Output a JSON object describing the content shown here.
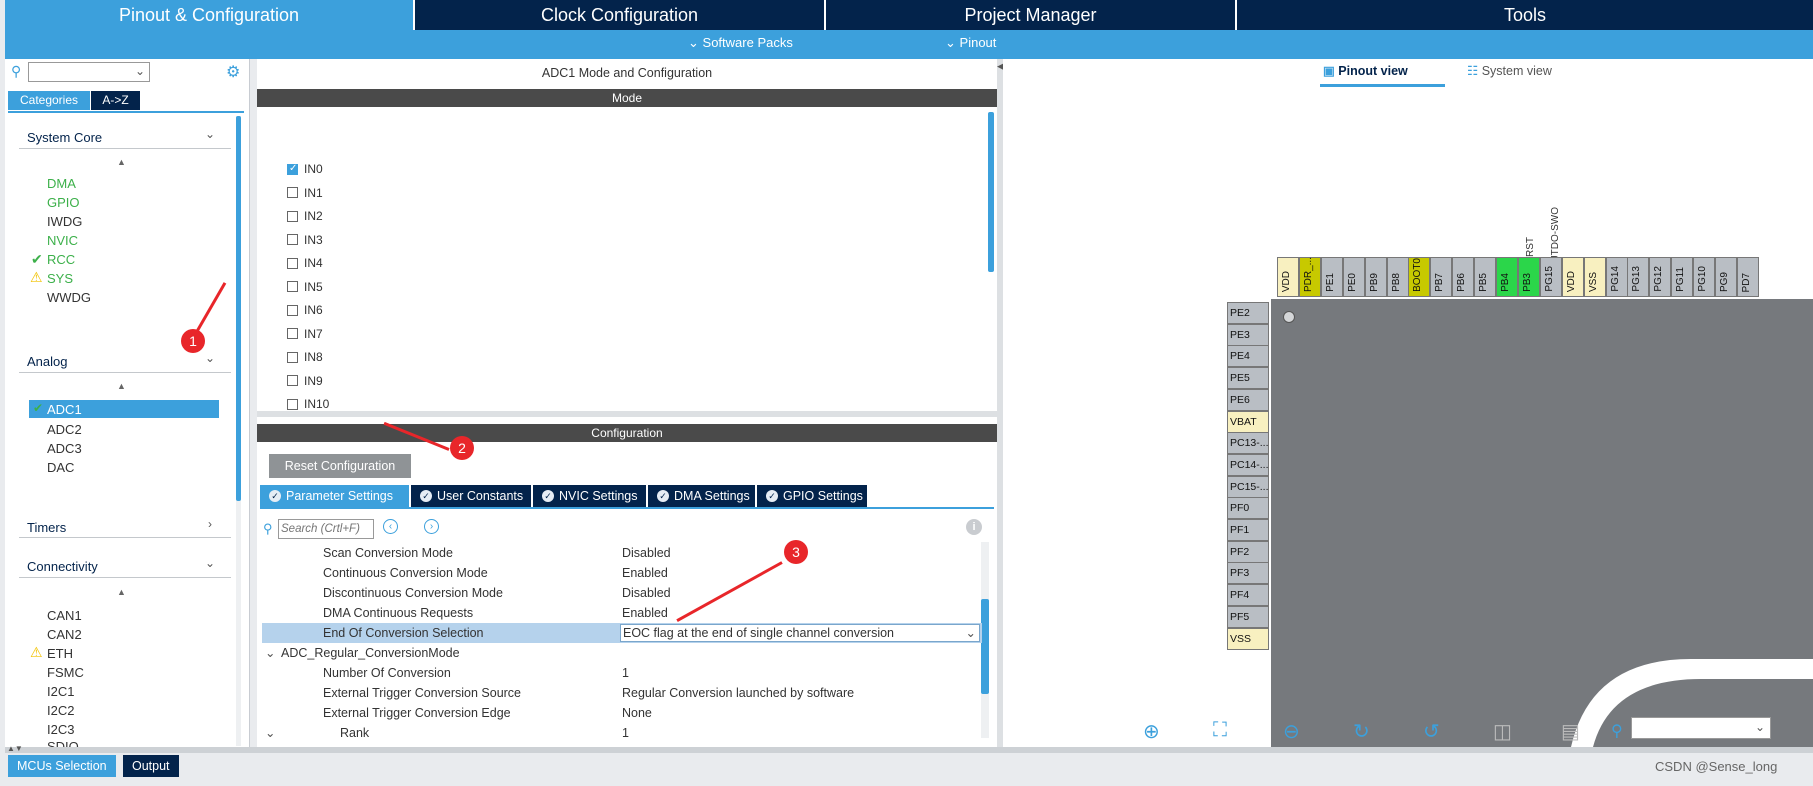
{
  "topnav": {
    "tabs": [
      {
        "label": "Pinout & Configuration"
      },
      {
        "label": "Clock Configuration"
      },
      {
        "label": "Project Manager"
      },
      {
        "label": "Tools"
      }
    ]
  },
  "subnav": {
    "software_packs": "Software Packs",
    "pinout": "Pinout"
  },
  "left": {
    "tab_categories": "Categories",
    "tab_az": "A->Z",
    "system_core": {
      "title": "System Core",
      "items": [
        {
          "label": "DMA",
          "status": "green"
        },
        {
          "label": "GPIO",
          "status": "green"
        },
        {
          "label": "IWDG",
          "status": "none"
        },
        {
          "label": "NVIC",
          "status": "green"
        },
        {
          "label": "RCC",
          "status": "check"
        },
        {
          "label": "SYS",
          "status": "warning"
        },
        {
          "label": "WWDG",
          "status": "none"
        }
      ]
    },
    "analog": {
      "title": "Analog",
      "items": [
        {
          "label": "ADC1",
          "status": "selected"
        },
        {
          "label": "ADC2",
          "status": "none"
        },
        {
          "label": "ADC3",
          "status": "none"
        },
        {
          "label": "DAC",
          "status": "none"
        }
      ]
    },
    "timers": {
      "title": "Timers"
    },
    "connectivity": {
      "title": "Connectivity",
      "items": [
        {
          "label": "CAN1",
          "status": "none"
        },
        {
          "label": "CAN2",
          "status": "none"
        },
        {
          "label": "ETH",
          "status": "warning"
        },
        {
          "label": "FSMC",
          "status": "none"
        },
        {
          "label": "I2C1",
          "status": "none"
        },
        {
          "label": "I2C2",
          "status": "none"
        },
        {
          "label": "I2C3",
          "status": "none"
        },
        {
          "label": "SDIO",
          "status": "none"
        }
      ]
    }
  },
  "center": {
    "title": "ADC1 Mode and Configuration",
    "mode_header": "Mode",
    "mode_items": [
      {
        "label": "IN0",
        "checked": true
      },
      {
        "label": "IN1",
        "checked": false
      },
      {
        "label": "IN2",
        "checked": false
      },
      {
        "label": "IN3",
        "checked": false
      },
      {
        "label": "IN4",
        "checked": false
      },
      {
        "label": "IN5",
        "checked": false
      },
      {
        "label": "IN6",
        "checked": false
      },
      {
        "label": "IN7",
        "checked": false
      },
      {
        "label": "IN8",
        "checked": false
      },
      {
        "label": "IN9",
        "checked": false
      },
      {
        "label": "IN10",
        "checked": false
      }
    ],
    "config_header": "Configuration",
    "reset_button": "Reset Configuration",
    "tabs": [
      {
        "label": "Parameter Settings"
      },
      {
        "label": "User Constants"
      },
      {
        "label": "NVIC Settings"
      },
      {
        "label": "DMA Settings"
      },
      {
        "label": "GPIO Settings"
      }
    ],
    "search_placeholder": "Search (Crtl+F)",
    "params": [
      {
        "name": "Scan Conversion Mode",
        "value": "Disabled"
      },
      {
        "name": "Continuous Conversion Mode",
        "value": "Enabled"
      },
      {
        "name": "Discontinuous Conversion Mode",
        "value": "Disabled"
      },
      {
        "name": "DMA Continuous Requests",
        "value": "Enabled"
      },
      {
        "name": "End Of Conversion Selection",
        "value": "EOC flag at the end of single channel conversion"
      },
      {
        "name": "ADC_Regular_ConversionMode",
        "value": ""
      },
      {
        "name": "Number Of Conversion",
        "value": "1"
      },
      {
        "name": "External Trigger Conversion Source",
        "value": "Regular Conversion launched by software"
      },
      {
        "name": "External Trigger Conversion Edge",
        "value": "None"
      },
      {
        "name": "Rank",
        "value": "1"
      }
    ]
  },
  "right": {
    "pinout_view": "Pinout view",
    "system_view": "System view",
    "top_labels": [
      "SYS_JTRST",
      "SYS_JTDO-SWO"
    ],
    "top_pins": [
      {
        "label": "VDD",
        "color": "#f8f0c0"
      },
      {
        "label": "PDR_...",
        "color": "#c7c900"
      },
      {
        "label": "PE1",
        "color": "#b9bec4"
      },
      {
        "label": "PE0",
        "color": "#b9bec4"
      },
      {
        "label": "PB9",
        "color": "#b9bec4"
      },
      {
        "label": "PB8",
        "color": "#b9bec4"
      },
      {
        "label": "BOOT0",
        "color": "#c7c900"
      },
      {
        "label": "PB7",
        "color": "#b9bec4"
      },
      {
        "label": "PB6",
        "color": "#b9bec4"
      },
      {
        "label": "PB5",
        "color": "#b9bec4"
      },
      {
        "label": "PB4",
        "color": "#2bd64a"
      },
      {
        "label": "PB3",
        "color": "#2bd64a"
      },
      {
        "label": "PG15",
        "color": "#b9bec4"
      },
      {
        "label": "VDD",
        "color": "#f8f0c0"
      },
      {
        "label": "VSS",
        "color": "#f8f0c0"
      },
      {
        "label": "PG14",
        "color": "#b9bec4"
      },
      {
        "label": "PG13",
        "color": "#b9bec4"
      },
      {
        "label": "PG12",
        "color": "#b9bec4"
      },
      {
        "label": "PG11",
        "color": "#b9bec4"
      },
      {
        "label": "PG10",
        "color": "#b9bec4"
      },
      {
        "label": "PG9",
        "color": "#b9bec4"
      },
      {
        "label": "PD7",
        "color": "#b9bec4"
      }
    ],
    "left_pins": [
      {
        "label": "PE2",
        "color": "#b9bec4"
      },
      {
        "label": "PE3",
        "color": "#b9bec4"
      },
      {
        "label": "PE4",
        "color": "#b9bec4"
      },
      {
        "label": "PE5",
        "color": "#b9bec4"
      },
      {
        "label": "PE6",
        "color": "#b9bec4"
      },
      {
        "label": "VBAT",
        "color": "#f8f0c0"
      },
      {
        "label": "PC13-...",
        "color": "#b9bec4"
      },
      {
        "label": "PC14-...",
        "color": "#b9bec4"
      },
      {
        "label": "PC15-...",
        "color": "#b9bec4"
      },
      {
        "label": "PF0",
        "color": "#b9bec4"
      },
      {
        "label": "PF1",
        "color": "#b9bec4"
      },
      {
        "label": "PF2",
        "color": "#b9bec4"
      },
      {
        "label": "PF3",
        "color": "#b9bec4"
      },
      {
        "label": "PF4",
        "color": "#b9bec4"
      },
      {
        "label": "PF5",
        "color": "#b9bec4"
      },
      {
        "label": "VSS",
        "color": "#f8f0c0"
      }
    ]
  },
  "bottom": {
    "mcus_selection": "MCUs Selection",
    "output": "Output",
    "watermark": "CSDN @Sense_long"
  },
  "annotations": [
    "1",
    "2",
    "3"
  ]
}
